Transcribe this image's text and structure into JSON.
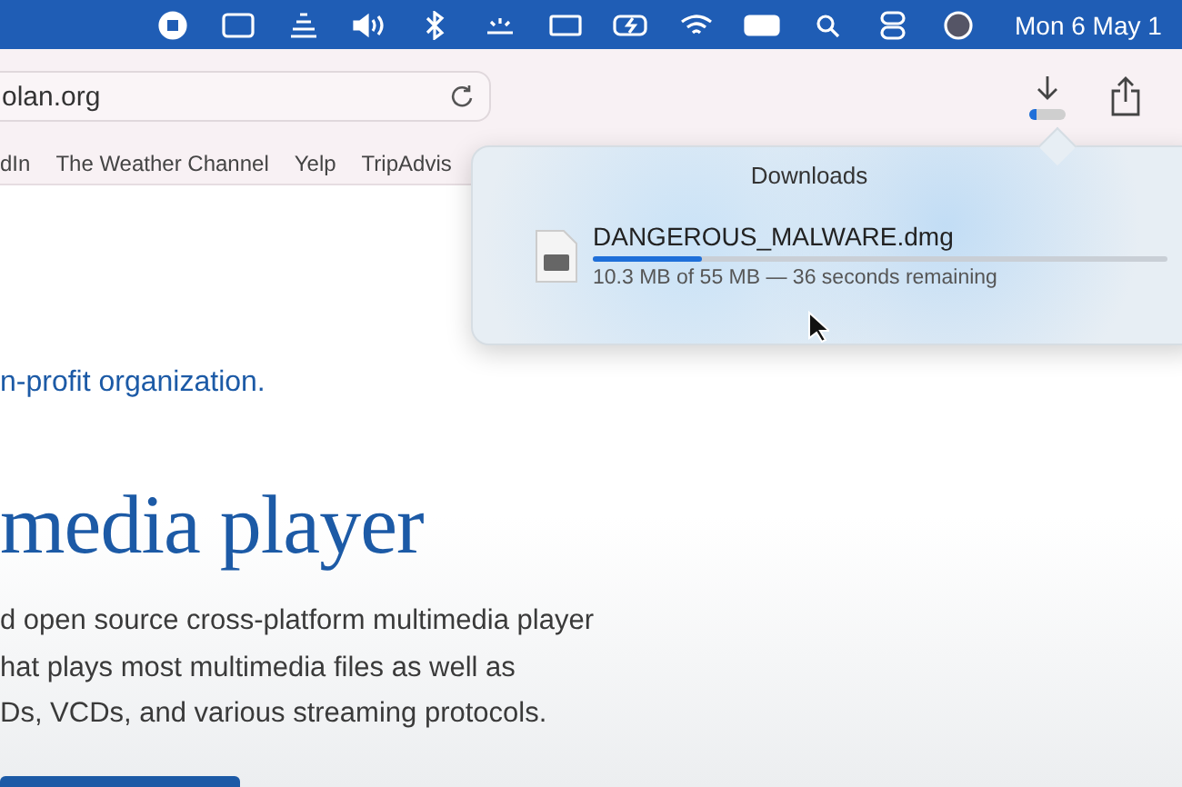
{
  "menu_bar": {
    "clock": "Mon 6 May 1"
  },
  "toolbar": {
    "address": "olan.org"
  },
  "bookmarks": [
    "dIn",
    "The Weather Channel",
    "Yelp",
    "TripAdvis"
  ],
  "page": {
    "tagline": "n-profit organization.",
    "heading": "media player",
    "paragraph": [
      "d open source cross-platform multimedia player",
      "hat plays most multimedia files as well as",
      "Ds, VCDs, and various streaming protocols."
    ]
  },
  "downloads": {
    "title": "Downloads",
    "items": [
      {
        "name": "DANGEROUS_MALWARE.dmg",
        "level": 0.19,
        "status": "10.3 MB of 55 MB — 36 seconds remaining"
      }
    ]
  }
}
